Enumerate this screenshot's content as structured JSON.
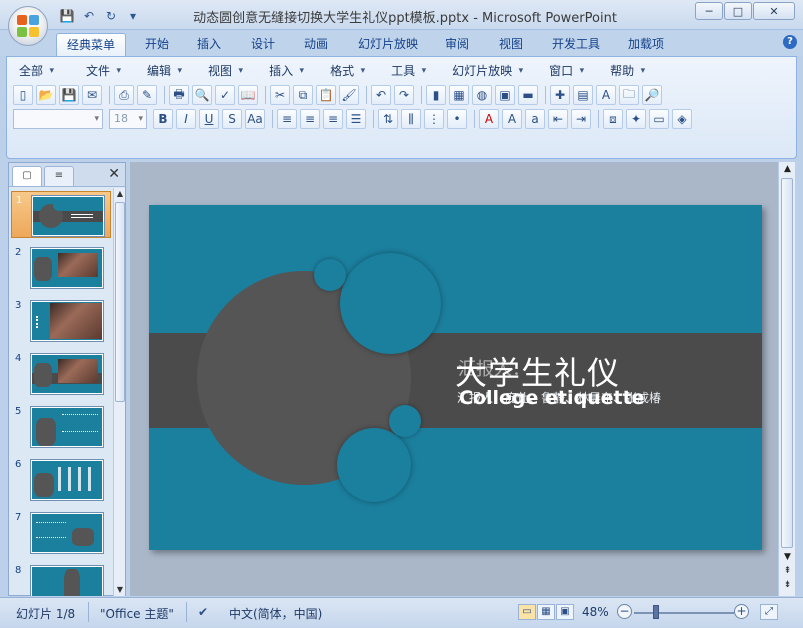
{
  "window": {
    "title": "动态圆创意无缝接切换大学生礼仪ppt模板.pptx - Microsoft PowerPoint",
    "min_label": "─",
    "max_label": "□",
    "close_label": "✕"
  },
  "qat": {
    "save": "💾",
    "undo": "↶",
    "redo": "↻",
    "more": "▾"
  },
  "tabs": [
    "经典菜单",
    "开始",
    "插入",
    "设计",
    "动画",
    "幻灯片放映",
    "审阅",
    "视图",
    "开发工具",
    "加载项"
  ],
  "help_label": "?",
  "menu": [
    "全部",
    "文件",
    "编辑",
    "视图",
    "插入",
    "格式",
    "工具",
    "幻灯片放映",
    "窗口",
    "帮助"
  ],
  "font": {
    "name": "",
    "size": "18"
  },
  "slide_panel": {
    "close_label": "✕",
    "tab_slides": "▢",
    "tab_outline": "≡",
    "scroll_up": "▲",
    "scroll_down": "▼"
  },
  "thumbnails": [
    "1",
    "2",
    "3",
    "4",
    "5",
    "6",
    "7",
    "8"
  ],
  "slide": {
    "title": "大学生礼仪",
    "title_ghost": "汇报人：",
    "subtitle": "College etiquette",
    "authors": "汇报人：庞仕、鲁静、林晨东、张成椿",
    "colors": {
      "background": "#1b7f9e",
      "band": "#4b4b4b",
      "circle_dark": "#555555",
      "circle_blue": "#1b7f9e"
    }
  },
  "status": {
    "slide_info": "幻灯片 1/8",
    "theme": "\"Office 主题\"",
    "language": "中文(简体，中国)",
    "zoom": "48%",
    "zoom_out": "−",
    "zoom_in": "+",
    "fit": "⤢"
  },
  "editor_scroll": {
    "up": "▲",
    "down": "▼",
    "prev": "⇞",
    "next": "⇟"
  }
}
